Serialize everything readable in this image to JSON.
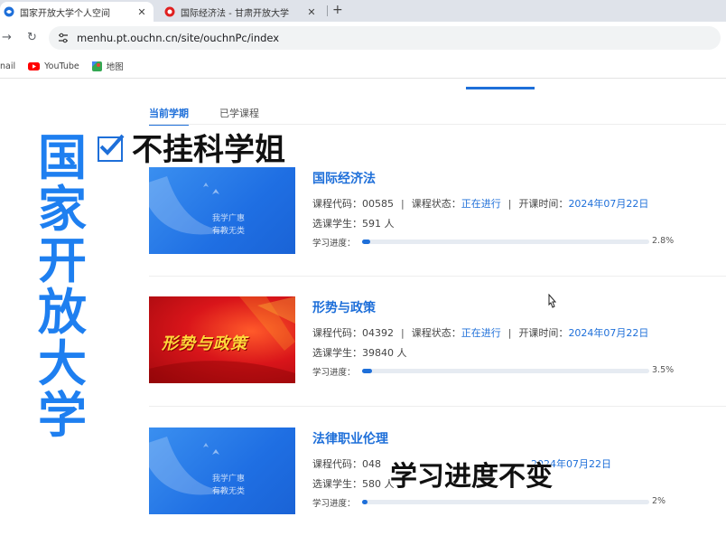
{
  "browser": {
    "tabs": [
      {
        "title": "国家开放大学个人空间",
        "active": true
      },
      {
        "title": "国际经济法 - 甘肃开放大学",
        "active": false
      }
    ],
    "close_glyph": "✕",
    "new_tab_glyph": "+",
    "url": "menhu.pt.ouchn.cn/site/ouchnPc/index",
    "bookmarks": [
      "nail",
      "YouTube",
      "地图"
    ]
  },
  "page": {
    "tabs": [
      "当前学期",
      "已学课程"
    ],
    "labels": {
      "code": "课程代码：",
      "status": "课程状态：",
      "start": "开课时间：",
      "students": "选课学生：",
      "progress": "学习进度：",
      "sep": "|"
    },
    "courses": [
      {
        "name": "国际经济法",
        "code": "00585",
        "status": "正在进行",
        "start": "2024年07月22日",
        "students": "591 人",
        "progress": 2.8,
        "progress_label": "2.8%",
        "thumb": "blue",
        "slogan1": "我学广惠",
        "slogan2": "有教无类"
      },
      {
        "name": "形势与政策",
        "code": "04392",
        "status": "正在进行",
        "start": "2024年07月22日",
        "students": "39840 人",
        "progress": 3.5,
        "progress_label": "3.5%",
        "thumb": "red",
        "thumb_title": "形势与政策"
      },
      {
        "name": "法律职业伦理",
        "code": "048",
        "status": "",
        "start": "2024年07月22日",
        "students": "580 人",
        "progress": 2,
        "progress_label": "2%",
        "thumb": "blue",
        "slogan1": "我学广惠",
        "slogan2": "有教无类"
      }
    ]
  },
  "overlay": {
    "vertical_title": [
      "国",
      "家",
      "开",
      "放",
      "大",
      "学"
    ],
    "check_title": "不挂科学姐",
    "caption": "学习进度不变"
  },
  "colors": {
    "accent": "#1e6fd9",
    "overlay_blue": "#1e7ff0",
    "red_thumb": "#d9151a"
  }
}
